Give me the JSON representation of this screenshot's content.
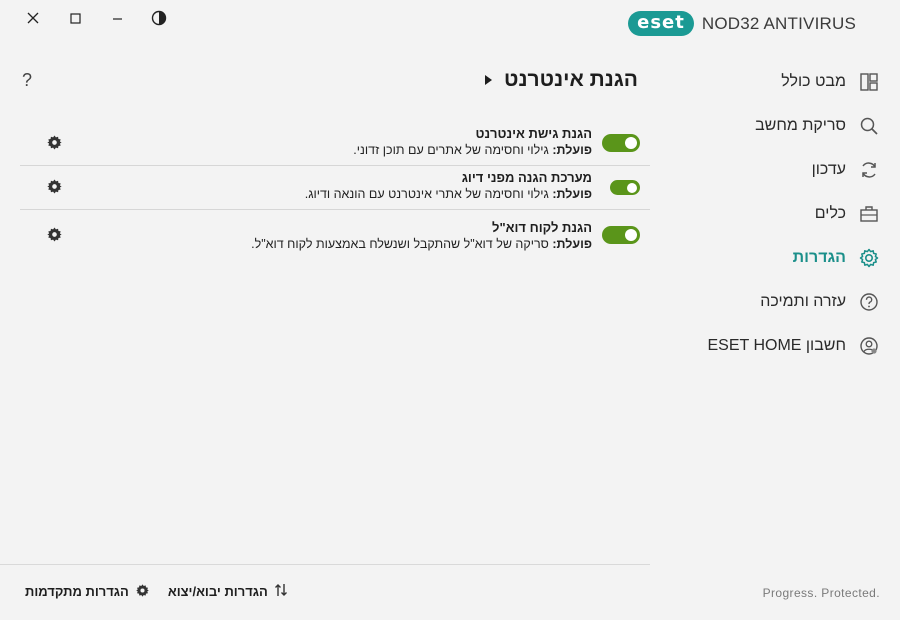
{
  "window": {
    "close_icon": "close-icon",
    "maximize_icon": "maximize-icon",
    "minimize_icon": "minimize-icon",
    "theme_icon": "contrast-icon"
  },
  "brand": {
    "logo_text": "eset",
    "product_name": "NOD32 ANTIVIRUS",
    "accent_color": "#1b9a94"
  },
  "sidebar": {
    "items": [
      {
        "label": "מבט כולל",
        "icon": "dashboard-icon",
        "active": false
      },
      {
        "label": "סריקת מחשב",
        "icon": "search-icon",
        "active": false
      },
      {
        "label": "עדכון",
        "icon": "refresh-icon",
        "active": false
      },
      {
        "label": "כלים",
        "icon": "briefcase-icon",
        "active": false
      },
      {
        "label": "הגדרות",
        "icon": "gear-icon",
        "active": true
      },
      {
        "label": "עזרה ותמיכה",
        "icon": "help-circle-icon",
        "active": false
      },
      {
        "label": "חשבון ESET HOME",
        "icon": "account-icon",
        "active": false
      }
    ]
  },
  "main": {
    "help_label": "?",
    "title": "הגנת אינטרנט",
    "settings": [
      {
        "title": "הגנת גישת אינטרנט",
        "status_prefix": "פועלת:",
        "status_text": " גילוי וחסימה של אתרים עם תוכן זדוני.",
        "enabled": true
      },
      {
        "title": "מערכת הגנה מפני דיוג",
        "status_prefix": "פועלת:",
        "status_text": " גילוי וחסימה של אתרי אינטרנט עם הונאה ודיוג.",
        "enabled": true
      },
      {
        "title": "הגנת לקוח דוא\"ל",
        "status_prefix": "פועלת:",
        "status_text": " סריקה של דוא\"ל שהתקבל ושנשלח באמצעות לקוח דוא\"ל.",
        "enabled": true
      }
    ],
    "toggle_color": "#5a951a"
  },
  "footer": {
    "import_export_label": "הגדרות יבוא/יצוא",
    "advanced_label": "הגדרות מתקדמות",
    "tagline": "Progress. Protected."
  }
}
